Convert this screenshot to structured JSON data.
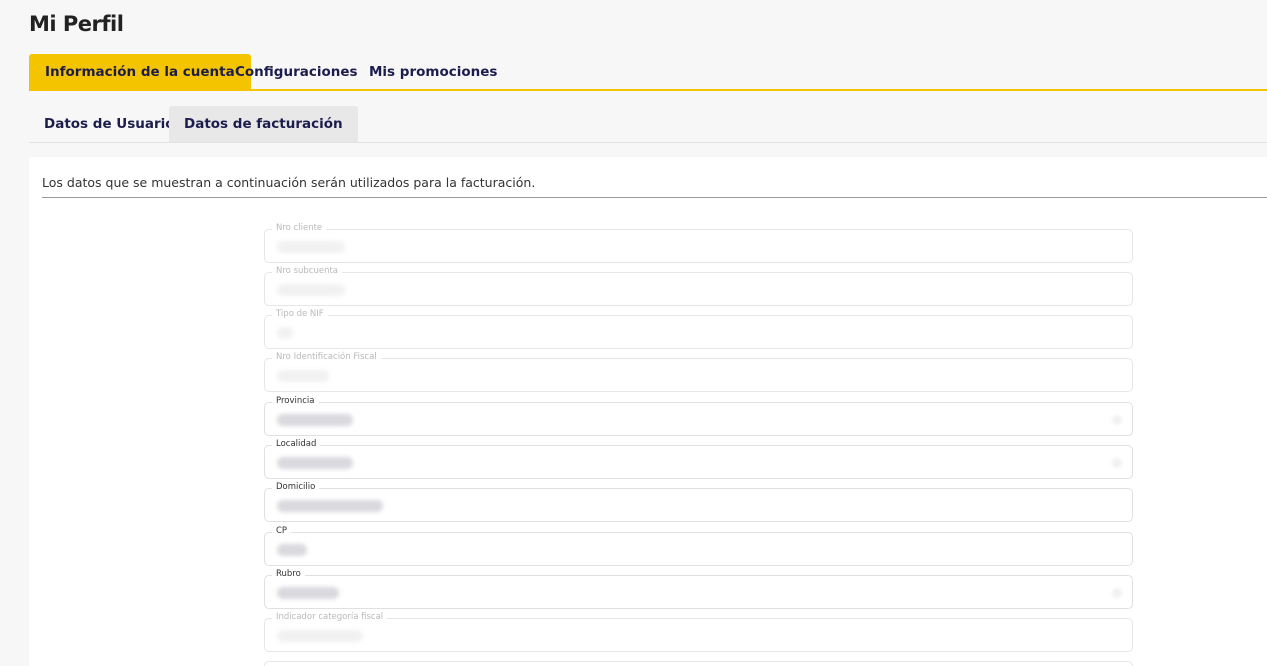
{
  "page": {
    "title": "Mi Perfil"
  },
  "main_tabs": [
    {
      "label": "Información de la cuenta",
      "active": true
    },
    {
      "label": "Configuraciones",
      "active": false
    },
    {
      "label": "Mis promociones",
      "active": false
    }
  ],
  "sub_tabs": [
    {
      "label": "Datos de Usuario",
      "active": false
    },
    {
      "label": "Datos de facturación",
      "active": true
    }
  ],
  "billing": {
    "intro": "Los datos que se muestran a continuación serán utilizados para la facturación.",
    "fields": [
      {
        "label": "Nro cliente",
        "value": "",
        "type": "text",
        "enabled": false
      },
      {
        "label": "Nro subcuenta",
        "value": "",
        "type": "text",
        "enabled": false
      },
      {
        "label": "Tipo de NIF",
        "value": "",
        "type": "text",
        "enabled": false
      },
      {
        "label": "Nro Identificación Fiscal",
        "value": "",
        "type": "text",
        "enabled": false
      },
      {
        "label": "Provincia",
        "value": "",
        "type": "select",
        "enabled": true
      },
      {
        "label": "Localidad",
        "value": "",
        "type": "select",
        "enabled": true
      },
      {
        "label": "Domicilio",
        "value": "",
        "type": "text",
        "enabled": true
      },
      {
        "label": "CP",
        "value": "",
        "type": "text",
        "enabled": true
      },
      {
        "label": "Rubro",
        "value": "",
        "type": "select",
        "enabled": true
      },
      {
        "label": "Indicador categoría fiscal",
        "value": "",
        "type": "text",
        "enabled": false
      }
    ]
  },
  "colors": {
    "accent": "#f5c400",
    "text_dark": "#1d1d4d",
    "page_bg": "#f7f7f7"
  }
}
